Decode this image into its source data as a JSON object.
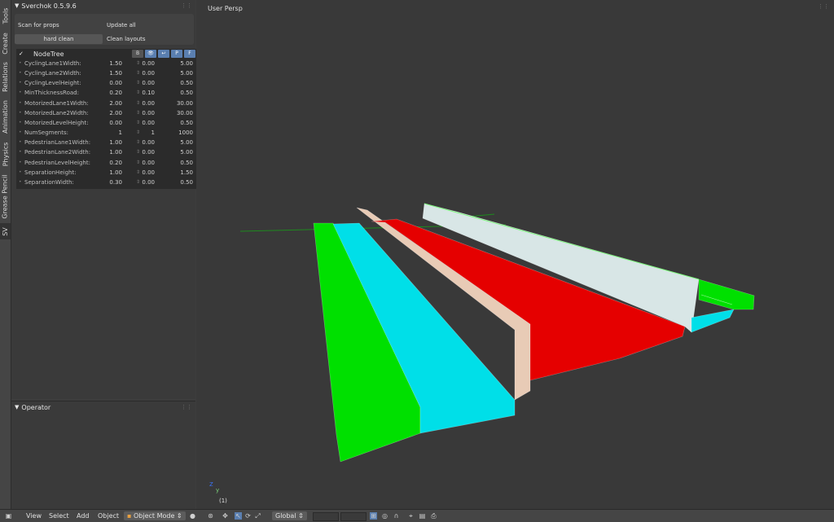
{
  "tabs": [
    "Tools",
    "Create",
    "Relations",
    "Animation",
    "Physics",
    "Grease Pencil",
    "SV"
  ],
  "panel": {
    "title": "Sverchok 0.5.9.6",
    "scan_label": "Scan for props",
    "update_all": "Update all",
    "hard_clean": "hard clean",
    "clean_layouts": "Clean layouts"
  },
  "nodetree": {
    "name": "NodeTree",
    "toggles": [
      "B",
      "👁",
      "↩",
      "P",
      "F"
    ]
  },
  "props": [
    {
      "name": "CyclingLane1Width:",
      "value": "1.50",
      "min": "0.00",
      "max": "5.00"
    },
    {
      "name": "CyclingLane2Width:",
      "value": "1.50",
      "min": "0.00",
      "max": "5.00"
    },
    {
      "name": "CyclingLevelHeight:",
      "value": "0.00",
      "min": "0.00",
      "max": "0.50"
    },
    {
      "name": "MinThicknessRoad:",
      "value": "0.20",
      "min": "0.10",
      "max": "0.50"
    },
    {
      "name": "MotorizedLane1Width:",
      "value": "2.00",
      "min": "0.00",
      "max": "30.00"
    },
    {
      "name": "MotorizedLane2Width:",
      "value": "2.00",
      "min": "0.00",
      "max": "30.00"
    },
    {
      "name": "MotorizedLevelHeight:",
      "value": "0.00",
      "min": "0.00",
      "max": "0.50"
    },
    {
      "name": "NumSegments:",
      "value": "1",
      "min": "1",
      "max": "1000"
    },
    {
      "name": "PedestrianLane1Width:",
      "value": "1.00",
      "min": "0.00",
      "max": "5.00"
    },
    {
      "name": "PedestrianLane2Width:",
      "value": "1.00",
      "min": "0.00",
      "max": "5.00"
    },
    {
      "name": "PedestrianLevelHeight:",
      "value": "0.20",
      "min": "0.00",
      "max": "0.50"
    },
    {
      "name": "SeparationHeight:",
      "value": "1.00",
      "min": "0.00",
      "max": "1.50"
    },
    {
      "name": "SeparationWidth:",
      "value": "0.30",
      "min": "0.00",
      "max": "0.50"
    }
  ],
  "operator": {
    "title": "Operator"
  },
  "viewport": {
    "label": "User Persp",
    "object_index": "(1)",
    "axis_z": "z",
    "axis_y": "y"
  },
  "header": {
    "menus": [
      "View",
      "Select",
      "Add",
      "Object"
    ],
    "mode": "Object Mode",
    "orientation": "Global"
  },
  "colors": {
    "green": "#00e000",
    "cyan": "#00dfe8",
    "beige": "#e8cbb6",
    "red": "#e50000",
    "lightgray": "#d8e6e6"
  }
}
